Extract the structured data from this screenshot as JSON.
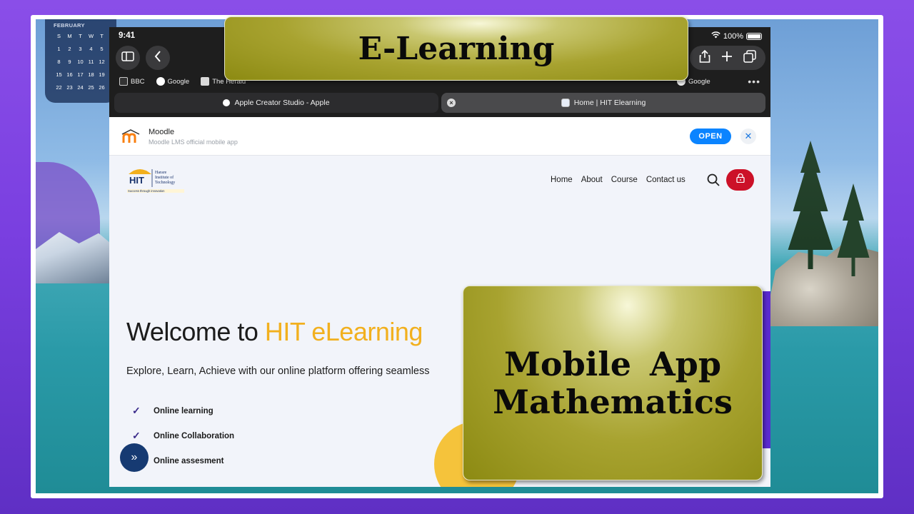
{
  "calendar": {
    "month": "FEBRUARY",
    "days_header": [
      "S",
      "M",
      "T",
      "W",
      "T"
    ],
    "rows": [
      [
        "1",
        "2",
        "3",
        "4",
        "5"
      ],
      [
        "8",
        "9",
        "10",
        "11",
        "12"
      ],
      [
        "15",
        "16",
        "17",
        "18",
        "19"
      ],
      [
        "22",
        "23",
        "24",
        "25",
        "26"
      ]
    ]
  },
  "status_bar": {
    "time": "9:41",
    "battery": "100%"
  },
  "bookmarks": [
    {
      "label": "BBC",
      "color": "#e8e8e8"
    },
    {
      "label": "Google",
      "color": "#4285f4"
    },
    {
      "label": "The Herald",
      "color": "#d9d9d9"
    }
  ],
  "bookmarks_right": {
    "label": "Google",
    "color": "#4285f4"
  },
  "tabs": [
    {
      "label": "Apple Creator Studio - Apple"
    },
    {
      "label": "Home | HIT Elearning"
    }
  ],
  "app_banner": {
    "title": "Moodle",
    "subtitle": "Moodle LMS official mobile app",
    "open_label": "OPEN",
    "close_icon": "close-icon"
  },
  "site": {
    "logo_text": "HIT",
    "logo_line1": "Harare",
    "logo_line2": "Institute of",
    "logo_line3": "Technology",
    "logo_tagline": "Success through innovation",
    "nav": [
      "Home",
      "About",
      "Course",
      "Contact us"
    ],
    "accent_color": "#f2b01e",
    "lock_color": "#cc1128"
  },
  "hero": {
    "title_prefix": "Welcome to ",
    "title_accent": "HIT eLearning",
    "description": "Explore, Learn, Achieve with our online platform offering seamless",
    "features": [
      "Online learning",
      "Online Collaboration",
      "Online assesment"
    ]
  },
  "overlays": {
    "top": "E-Learning",
    "bottom_line1": "Mobile App",
    "bottom_line2": "Mathematics"
  }
}
